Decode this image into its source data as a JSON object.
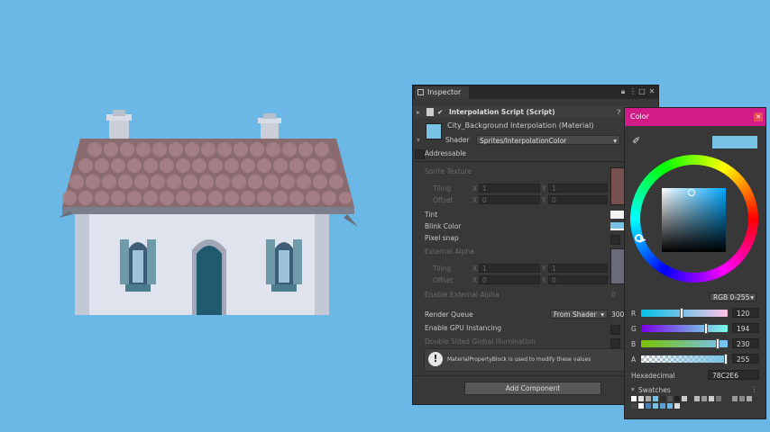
{
  "inspector": {
    "tab_label": "Inspector",
    "script_label": "Interpolation Script (Script)",
    "material_name": "City_Background Interpolation (Material)",
    "shader_label": "Shader",
    "shader_value": "Sprites/InterpolationColor",
    "addressable_label": "Addressable",
    "sprite_texture_label": "Sprite Texture",
    "tiling_label": "Tiling",
    "offset_label": "Offset",
    "x_label": "X",
    "y_label": "Y",
    "one": "1",
    "zero": "0",
    "tint_label": "Tint",
    "blink_color_label": "Blink Color",
    "pixel_snap_label": "Pixel snap",
    "external_alpha_label": "External Alpha",
    "enable_external_alpha_label": "Enable External Alpha",
    "enable_external_alpha_value": "0",
    "render_queue_label": "Render Queue",
    "render_queue_dropdown": "From Shader",
    "render_queue_value": "300",
    "gpu_instancing_label": "Enable GPU Instancing",
    "double_sided_label": "Double Sided Global Illumination",
    "info_message": "MaterialPropertyBlock is used to modify these values",
    "add_component_label": "Add Component"
  },
  "color_picker": {
    "title": "Color",
    "mode": "RGB 0-255",
    "channels": [
      {
        "label": "R",
        "value": "120",
        "fraction": 0.47
      },
      {
        "label": "G",
        "value": "194",
        "fraction": 0.76
      },
      {
        "label": "B",
        "value": "230",
        "fraction": 0.9
      },
      {
        "label": "A",
        "value": "255",
        "fraction": 1.0
      }
    ],
    "hex_label": "Hexadecimal",
    "hex_value": "78C2E6",
    "swatches_label": "Swatches",
    "current_color": "#78C2E6"
  },
  "colors": {
    "background": "#6bb7e6",
    "title_accent": "#d11c87",
    "panel": "#383838"
  }
}
